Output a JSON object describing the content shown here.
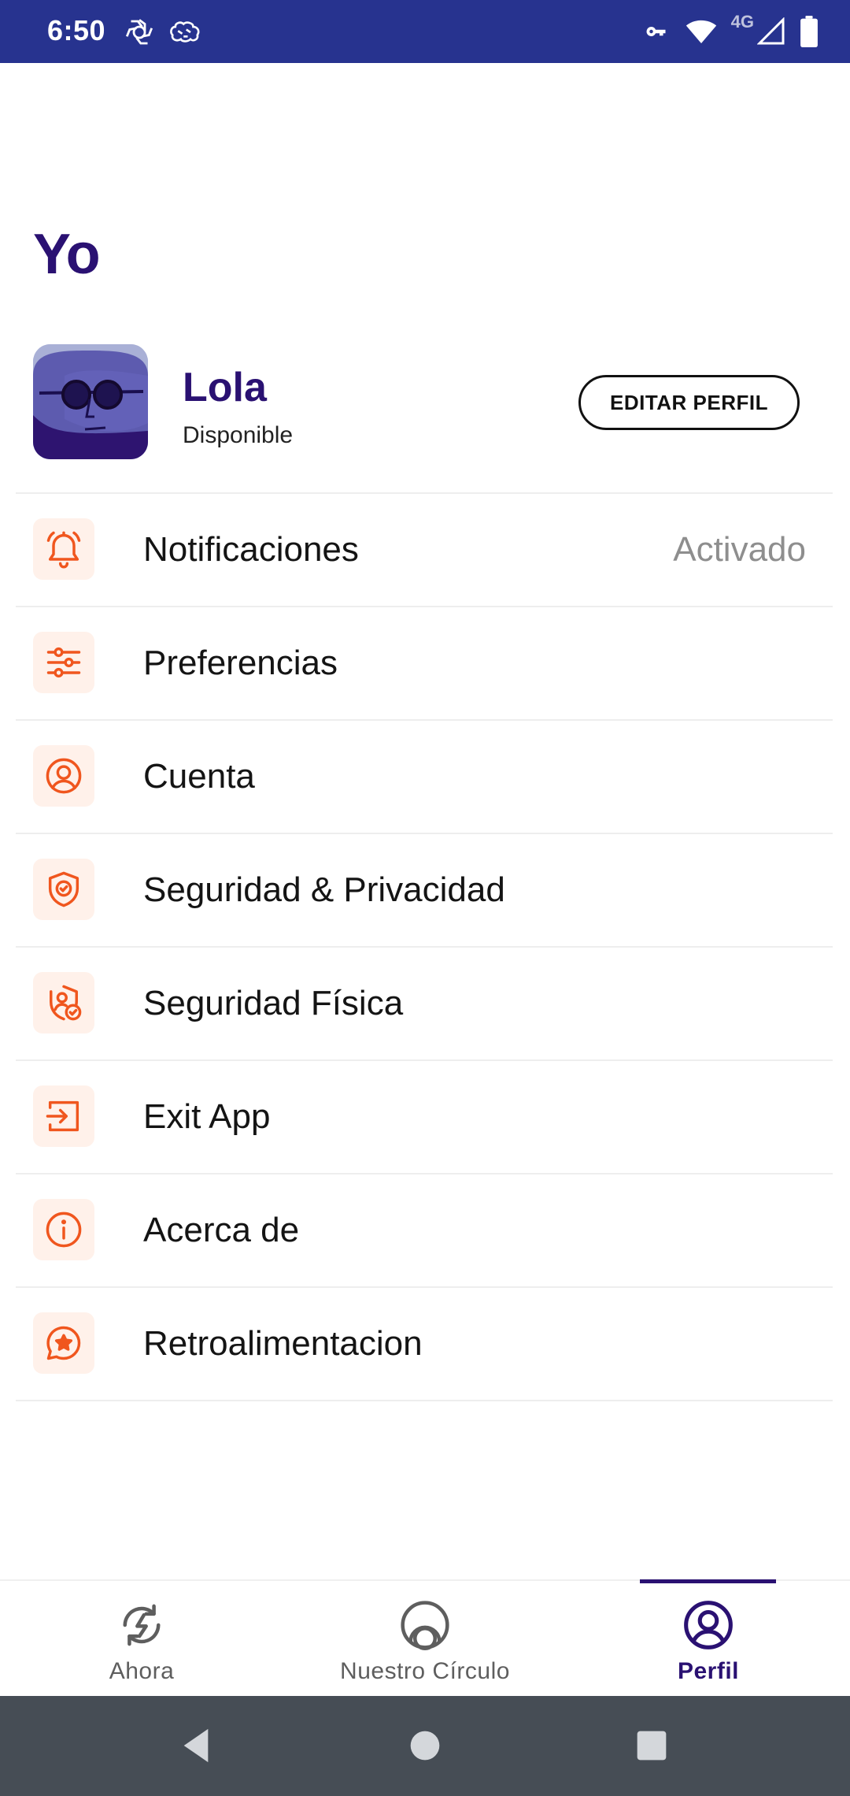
{
  "status_bar": {
    "time": "6:50",
    "network_label": "4G",
    "icons": [
      "openai-icon",
      "brain-icon",
      "vpn-key-icon",
      "wifi-icon",
      "signal-icon",
      "battery-icon"
    ],
    "background_color": "#27338F"
  },
  "page": {
    "title": "Yo"
  },
  "profile": {
    "name": "Lola",
    "status": "Disponible",
    "edit_button_label": "EDITAR PERFIL"
  },
  "menu": {
    "accent_color": "#F0561E",
    "items": [
      {
        "label": "Notificaciones",
        "value": "Activado",
        "icon": "bell-icon"
      },
      {
        "label": "Preferencias",
        "icon": "sliders-icon"
      },
      {
        "label": "Cuenta",
        "icon": "user-circle-icon"
      },
      {
        "label": "Seguridad & Privacidad",
        "icon": "shield-check-icon"
      },
      {
        "label": "Seguridad Física",
        "icon": "shield-user-icon"
      },
      {
        "label": "Exit App",
        "icon": "exit-icon"
      },
      {
        "label": "Acerca de",
        "icon": "info-icon"
      },
      {
        "label": "Retroalimentacion",
        "icon": "feedback-star-icon"
      }
    ]
  },
  "bottom_nav": {
    "active_color": "#2A1172",
    "items": [
      {
        "label": "Ahora",
        "icon": "refresh-bolt-icon"
      },
      {
        "label": "Nuestro Círculo",
        "icon": "circle-icon"
      },
      {
        "label": "Perfil",
        "icon": "profile-icon",
        "active": true
      }
    ]
  },
  "system_nav": {
    "buttons": [
      "back-icon",
      "home-icon",
      "recents-icon"
    ]
  }
}
